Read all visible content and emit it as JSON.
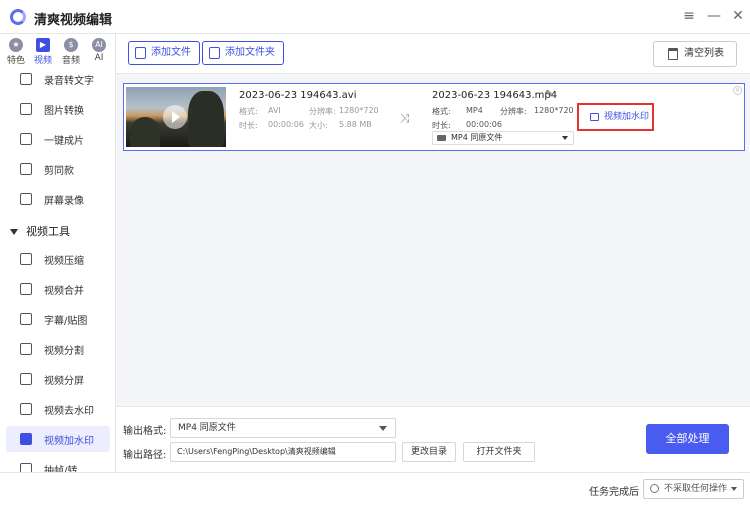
{
  "app": {
    "title": "清爽视频编辑"
  },
  "window": {
    "menu_icon": "≡",
    "minimize_icon": "—",
    "close_icon": "✕"
  },
  "categories": [
    {
      "label": "特色",
      "glyph": "★"
    },
    {
      "label": "视频",
      "glyph": "▶"
    },
    {
      "label": "音频",
      "glyph": "$"
    },
    {
      "label": "AI",
      "glyph": "AI"
    }
  ],
  "nav": {
    "items_top": [
      "录音转文字",
      "图片转换",
      "一键成片",
      "剪同款",
      "屏幕录像"
    ],
    "section_title": "视频工具",
    "items_tools": [
      "视频压缩",
      "视频合并",
      "字幕/贴图",
      "视频分割",
      "视频分屏",
      "视频去水印",
      "视频加水印",
      "抽帧/转"
    ]
  },
  "toolbar": {
    "add_file": "添加文件",
    "add_folder": "添加文件夹",
    "clear_list": "清空列表"
  },
  "file": {
    "source": {
      "name": "2023-06-23 194643.avi",
      "format_label": "格式:",
      "format": "AVI",
      "res_label": "分辨率:",
      "resolution": "1280*720",
      "duration_label": "时长:",
      "duration": "00:00:06",
      "size_label": "大小:",
      "size": "5.88 MB"
    },
    "output": {
      "name": "2023-06-23 194643.mp4",
      "format_label": "格式:",
      "format": "MP4",
      "res_label": "分辨率:",
      "resolution": "1280*720",
      "duration_label": "时长:",
      "duration": "00:00:06",
      "select_value": "MP4  同原文件"
    },
    "pencil_icon": "✎",
    "shuffle_icon": "⤨",
    "watermark_button": "视频加水印"
  },
  "bottom": {
    "format_label": "输出格式:",
    "format_value": "MP4  同原文件",
    "path_label": "输出路径:",
    "path_value": "C:\\Users\\FengPing\\Desktop\\清爽视频编辑",
    "change_dir": "更改目录",
    "open_folder": "打开文件夹",
    "process_all": "全部处理"
  },
  "status": {
    "label": "任务完成后",
    "value": "不采取任何操作"
  }
}
